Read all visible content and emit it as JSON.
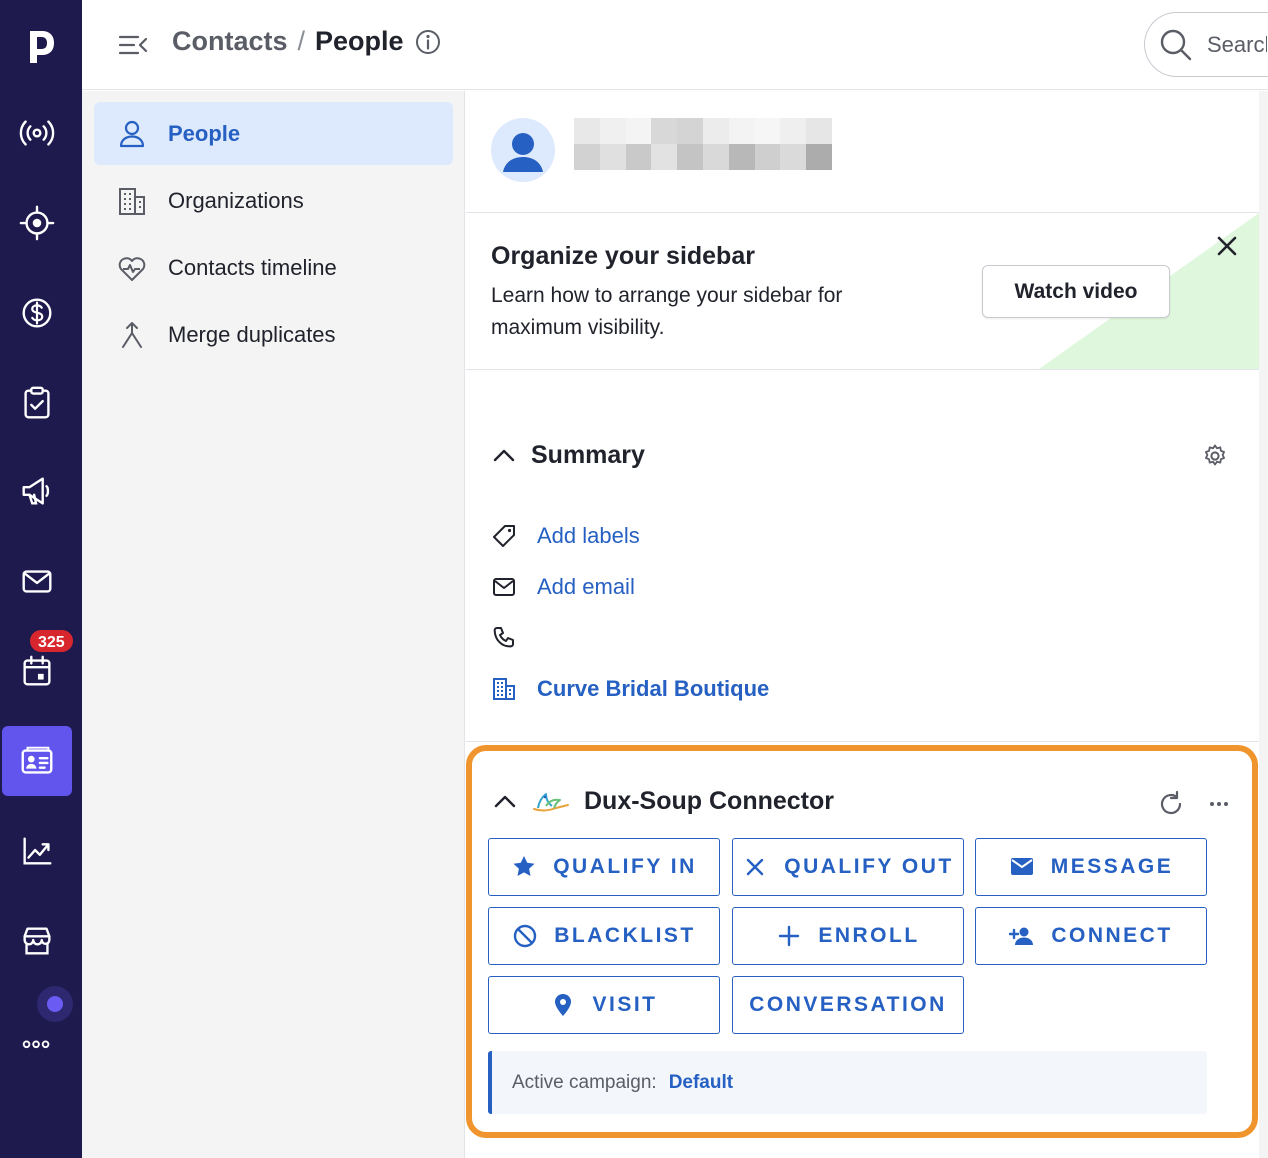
{
  "rail": {
    "badge_count": "325",
    "active_item": "contacts"
  },
  "topbar": {
    "breadcrumb_parent": "Contacts",
    "breadcrumb_separator": "/",
    "breadcrumb_current": "People",
    "search_placeholder": "Search"
  },
  "nav": {
    "items": [
      {
        "label": "People",
        "icon": "person-icon",
        "active": true
      },
      {
        "label": "Organizations",
        "icon": "building-icon",
        "active": false
      },
      {
        "label": "Contacts timeline",
        "icon": "heartbeat-icon",
        "active": false
      },
      {
        "label": "Merge duplicates",
        "icon": "merge-icon",
        "active": false
      }
    ]
  },
  "promo": {
    "title": "Organize your sidebar",
    "text": "Learn how to arrange your sidebar for maximum visibility.",
    "button_label": "Watch video"
  },
  "summary": {
    "title": "Summary",
    "add_labels": "Add labels",
    "add_email": "Add email",
    "phone": "",
    "organization": "Curve Bridal Boutique"
  },
  "dux": {
    "title": "Dux-Soup Connector",
    "buttons": [
      {
        "label": "QUALIFY IN",
        "icon": "star-icon"
      },
      {
        "label": "QUALIFY OUT",
        "icon": "x-icon"
      },
      {
        "label": "MESSAGE",
        "icon": "envelope-icon"
      },
      {
        "label": "BLACKLIST",
        "icon": "ban-icon"
      },
      {
        "label": "ENROLL",
        "icon": "plus-icon"
      },
      {
        "label": "CONNECT",
        "icon": "add-person-icon"
      },
      {
        "label": "VISIT",
        "icon": "location-pin-icon"
      },
      {
        "label": "CONVERSATION",
        "icon": ""
      }
    ],
    "campaign_label": "Active campaign:",
    "campaign_value": "Default"
  },
  "colors": {
    "rail_bg": "#1f1a4d",
    "rail_active": "#6155ee",
    "accent_blue": "#2560c2",
    "highlight_orange": "#f0952d",
    "badge_red": "#d7262e",
    "promo_green": "#dff7dc"
  }
}
